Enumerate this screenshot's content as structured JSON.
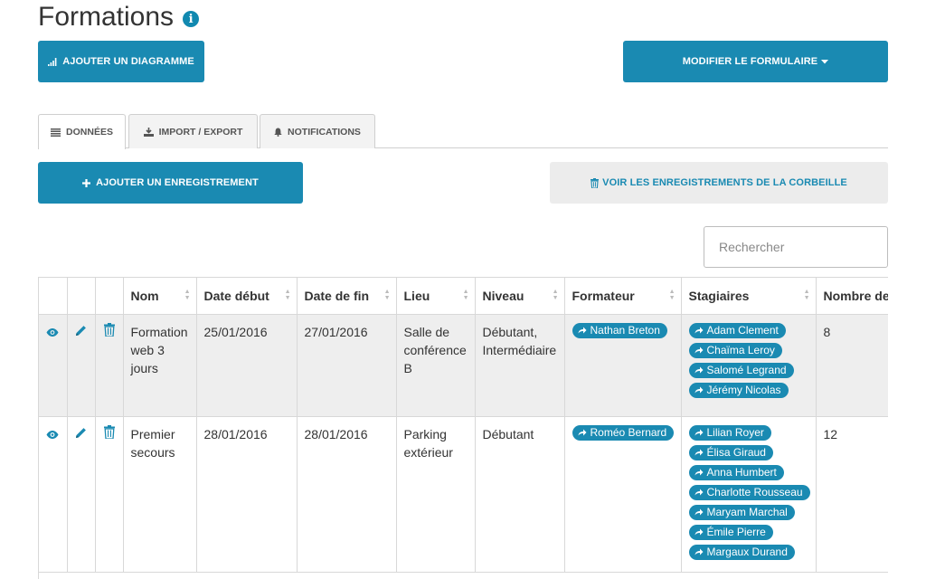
{
  "page": {
    "title": "Formations"
  },
  "toolbar": {
    "add_chart_label": "AJOUTER UN DIAGRAMME",
    "edit_form_label": "MODIFIER LE FORMULAIRE"
  },
  "tabs": [
    {
      "label": "DONNÉES",
      "icon": "list-icon",
      "active": true
    },
    {
      "label": "IMPORT / EXPORT",
      "icon": "import-export-icon",
      "active": false
    },
    {
      "label": "NOTIFICATIONS",
      "icon": "bell-icon",
      "active": false
    }
  ],
  "actions": {
    "add_record_label": "AJOUTER UN ENREGISTREMENT",
    "trash_label": "VOIR LES ENREGISTREMENTS DE LA CORBEILLE"
  },
  "search": {
    "placeholder": "Rechercher",
    "value": ""
  },
  "table": {
    "columns": [
      "Nom",
      "Date début",
      "Date de fin",
      "Lieu",
      "Niveau",
      "Formateur",
      "Stagiaires",
      "Nombre de"
    ],
    "rows": [
      {
        "nom": "Formation web 3 jours",
        "date_debut": "25/01/2016",
        "date_fin": "27/01/2016",
        "lieu": "Salle de conférence B",
        "niveau": "Débutant, Intermédiaire",
        "formateur": "Nathan Breton",
        "stagiaires": [
          "Adam Clement",
          "Chaïma Leroy",
          "Salomé Legrand",
          "Jérémy Nicolas"
        ],
        "nombre": "8"
      },
      {
        "nom": "Premier secours",
        "date_debut": "28/01/2016",
        "date_fin": "28/01/2016",
        "lieu": "Parking extérieur",
        "niveau": "Débutant",
        "formateur": "Roméo Bernard",
        "stagiaires": [
          "Lilian Royer",
          "Élisa Giraud",
          "Anna Humbert",
          "Charlotte Rousseau",
          "Maryam Marchal",
          "Émile Pierre",
          "Margaux Durand"
        ],
        "nombre": "12"
      }
    ]
  },
  "colors": {
    "accent": "#1a8ab2",
    "row_shade": "#eeeeee",
    "light_button": "#ececec"
  }
}
